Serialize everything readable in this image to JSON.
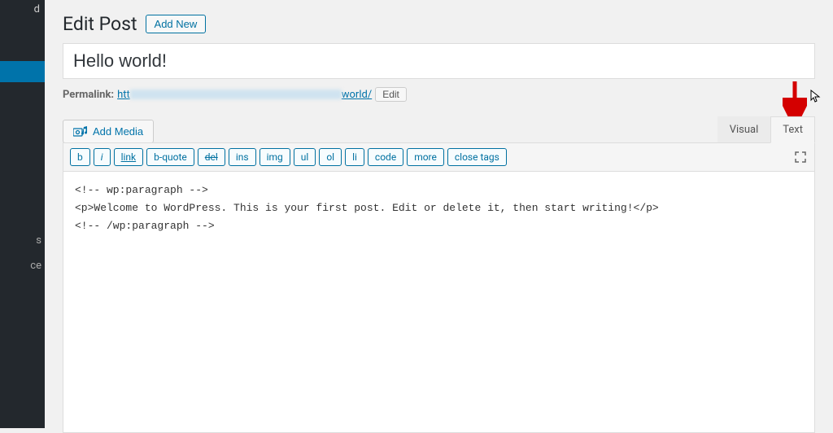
{
  "sidebar": {
    "top_item_fragment": "d",
    "items": [
      "s",
      "ce"
    ]
  },
  "heading": {
    "title": "Edit Post",
    "add_new_label": "Add New"
  },
  "post": {
    "title_value": "Hello world!"
  },
  "permalink": {
    "label": "Permalink:",
    "prefix": "htt",
    "suffix": "world/",
    "edit_label": "Edit"
  },
  "media": {
    "add_media_label": "Add Media"
  },
  "tabs": {
    "visual": "Visual",
    "text": "Text"
  },
  "quicktags": {
    "b": "b",
    "i": "i",
    "link": "link",
    "bquote": "b-quote",
    "del": "del",
    "ins": "ins",
    "img": "img",
    "ul": "ul",
    "ol": "ol",
    "li": "li",
    "code": "code",
    "more": "more",
    "close": "close tags"
  },
  "editor": {
    "content": "<!-- wp:paragraph -->\n<p>Welcome to WordPress. This is your first post. Edit or delete it, then start writing!</p>\n<!-- /wp:paragraph -->"
  }
}
